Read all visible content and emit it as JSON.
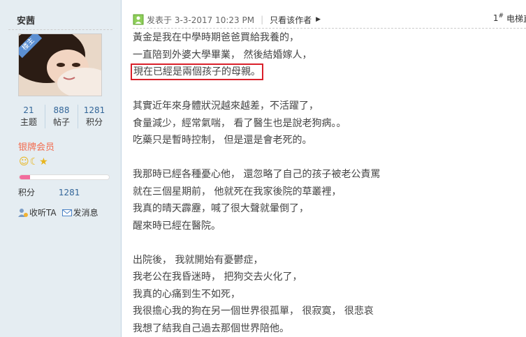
{
  "sidebar": {
    "username": "安茜",
    "badge": "楼主",
    "stats": [
      {
        "value": "21",
        "label": "主题"
      },
      {
        "value": "888",
        "label": "帖子"
      },
      {
        "value": "1281",
        "label": "积分"
      }
    ],
    "group": "银牌会员",
    "rank_icons": [
      "smiley-icon",
      "moon-icon",
      "star-icon"
    ],
    "progress_fraction": 0.12,
    "points_label": "积分",
    "points_value": "1281",
    "follow_label": "收听TA",
    "message_label": "发消息"
  },
  "post": {
    "posted_label": "发表于 3-3-2017 10:23 PM",
    "author_only": "只看该作者",
    "floor": "1",
    "floor_mark": "#",
    "floor_link": "电梯直达",
    "paragraphs": [
      [
        "黃金是我在中學時期爸爸買給我養的，",
        "一直陪到外婆大學畢業， 然後結婚嫁人，",
        "現在已經是兩個孩子的母親。"
      ],
      [
        "其實近年來身體狀況越來越差，不活躍了，",
        "食量減少，經常氣喘， 看了醫生也是說老狗病。。",
        "吃藥只是暫時控制， 但是還是會老死的。"
      ],
      [
        "我那時已經各種憂心他， 還忽略了自己的孩子被老公責罵",
        "就在三個星期前， 他就死在我家後院的草叢裡，",
        "我真的晴天霹靂，喊了很大聲就暈倒了，",
        "醒來時已經在醫院。"
      ],
      [
        "出院後， 我就開始有憂鬱症，",
        "我老公在我昏迷時， 把狗交去火化了，",
        "我真的心痛到生不如死，",
        "我很擔心我的狗在另一個世界很孤單， 很寂寞， 很悲哀",
        "我想了結我自己過去那個世界陪他。"
      ]
    ]
  },
  "colors": {
    "sidebar_bg": "#e5edf2",
    "highlight_border": "#d9202a",
    "group_color": "#f26c4f",
    "link": "#336699"
  }
}
